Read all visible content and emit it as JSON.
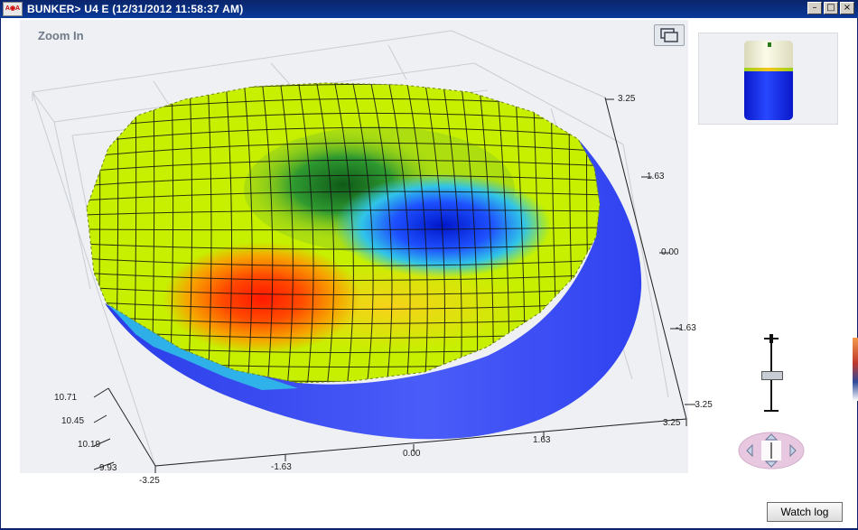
{
  "window": {
    "title": "BUNKER> U4 E (12/31/2012 11:58:37 AM)",
    "app_icon": "AOA-logo",
    "controls": [
      "minimize-icon",
      "maximize-icon",
      "close-icon"
    ]
  },
  "plot": {
    "zoom_label": "Zoom In",
    "restore_icon": "restore-view-icon",
    "axis_z_ticks": [
      "10.71",
      "10.45",
      "10.19",
      "9.93"
    ],
    "axis_x_ticks": [
      "-3.25",
      "-1.63",
      "0.00",
      "1.63",
      "3.25"
    ],
    "axis_y_ticks": [
      "3.25",
      "1.63",
      "0.00",
      "-1.63",
      "-3.25"
    ],
    "surface_colors": {
      "low": "#1a3cff",
      "mid_low": "#2ec3e8",
      "mid": "#38b63a",
      "mid_high": "#c6f000",
      "high": "#ff2a00",
      "cylinder": "#3a4cf0"
    }
  },
  "thumbnail": {
    "fill_level": 0.62,
    "fill_color": "#1e3cff",
    "empty_color": "#f4f3df"
  },
  "zoom_slider": {
    "level": 0.5,
    "plus_icon": "zoom-in-icon",
    "minus_icon": "zoom-out-icon"
  },
  "pan_control": {
    "icons": [
      "pan-up-icon",
      "pan-down-icon",
      "pan-left-icon",
      "pan-right-icon"
    ]
  },
  "footer": {
    "watch_log_label": "Watch log"
  }
}
